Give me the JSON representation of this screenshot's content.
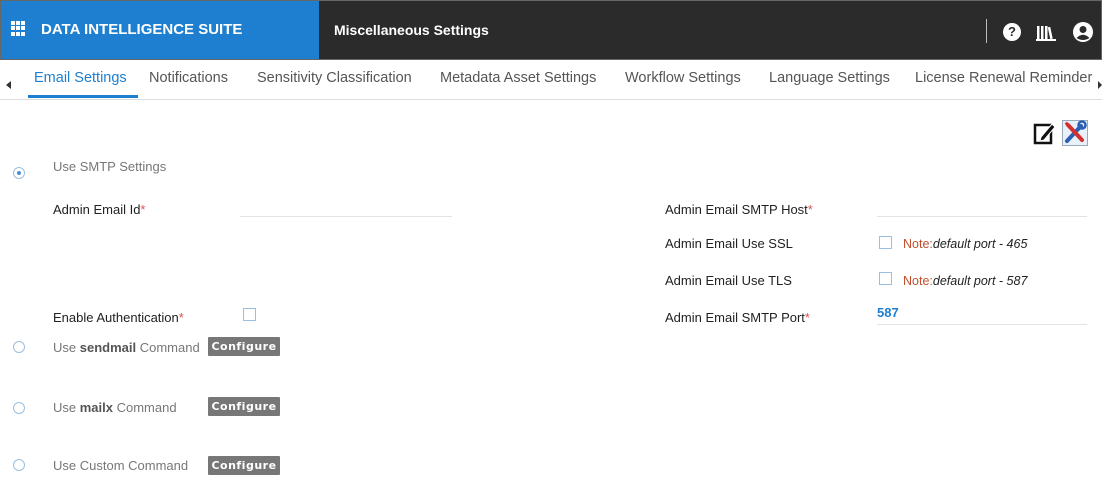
{
  "header": {
    "brand_title": "DATA INTELLIGENCE SUITE",
    "page_title": "Miscellaneous Settings",
    "help_glyph": "?",
    "brand_color": "#1e7fd0",
    "bar_color": "#2b2b2b"
  },
  "tabs": [
    {
      "label": "Email Settings",
      "active": true
    },
    {
      "label": "Notifications",
      "active": false
    },
    {
      "label": "Sensitivity Classification",
      "active": false
    },
    {
      "label": "Metadata Asset Settings",
      "active": false
    },
    {
      "label": "Workflow Settings",
      "active": false
    },
    {
      "label": "Language Settings",
      "active": false
    },
    {
      "label": "License Renewal Reminder",
      "active": false
    }
  ],
  "toolbar": {
    "edit_icon": "pencil-edit-icon",
    "tools_icon": "screwdriver-wrench-icon"
  },
  "email": {
    "smtp_option": "Use SMTP Settings",
    "admin_email_id": {
      "label": "Admin Email Id",
      "required": "*",
      "value": ""
    },
    "enable_auth": {
      "label": "Enable Authentication",
      "required": "*",
      "checked": false
    },
    "smtp_host": {
      "label": "Admin Email SMTP Host",
      "required": "*",
      "value": ""
    },
    "use_ssl": {
      "label": "Admin Email Use SSL",
      "checked": false,
      "note_label": "Note:",
      "note_text": "default port - 465"
    },
    "use_tls": {
      "label": "Admin Email Use TLS",
      "checked": false,
      "note_label": "Note:",
      "note_text": "default port - 587"
    },
    "smtp_port": {
      "label": "Admin Email SMTP Port",
      "required": "*",
      "value": "587"
    },
    "sendmail": {
      "prefix": "Use ",
      "bold": "sendmail",
      "suffix": " Command",
      "button": "Configure"
    },
    "mailx": {
      "prefix": "Use ",
      "bold": "mailx",
      "suffix": " Command",
      "button": "Configure"
    },
    "custom": {
      "label": "Use Custom Command",
      "button": "Configure"
    }
  }
}
